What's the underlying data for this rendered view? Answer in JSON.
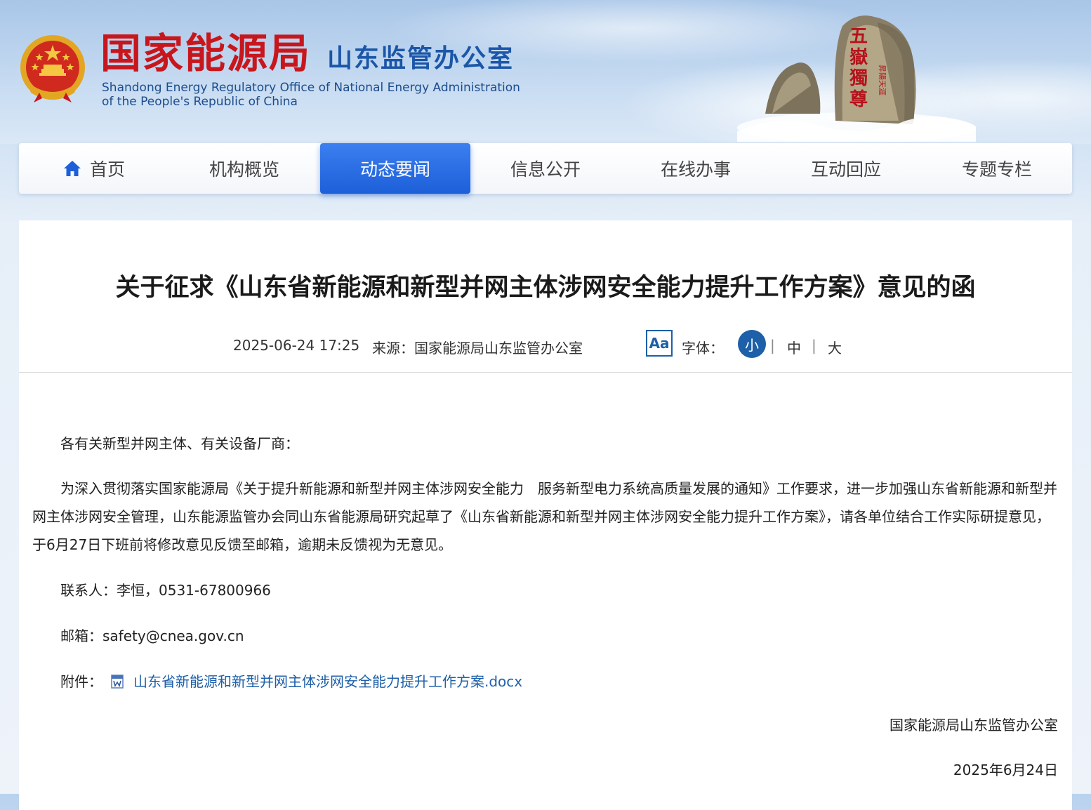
{
  "header": {
    "org_cn": "国家能源局",
    "office_cn": "山东监管办公室",
    "org_en_line1": "Shandong Energy Regulatory Office of National Energy Administration",
    "org_en_line2": "of the People's Republic of China",
    "mountain_inscription": "五嶽獨尊"
  },
  "nav": {
    "items": [
      {
        "label": "首页",
        "icon": "home-icon",
        "active": false
      },
      {
        "label": "机构概览",
        "active": false
      },
      {
        "label": "动态要闻",
        "active": true
      },
      {
        "label": "信息公开",
        "active": false
      },
      {
        "label": "在线办事",
        "active": false
      },
      {
        "label": "互动回应",
        "active": false
      },
      {
        "label": "专题专栏",
        "active": false
      }
    ],
    "active_color": "#1d5fd8"
  },
  "article": {
    "title": "关于征求《山东省新能源和新型并网主体涉网安全能力提升工作方案》意见的函",
    "date": "2025-06-24 17:25",
    "source": "来源：国家能源局山东监管办公室",
    "font_icon_text": "Aa",
    "font_label": "字体：",
    "font_sizes": {
      "small": "小",
      "medium": "中",
      "large": "大",
      "selected": "小",
      "separator": "|"
    },
    "greeting": "各有关新型并网主体、有关设备厂商：",
    "body": "为深入贯彻落实国家能源局《关于提升新能源和新型并网主体涉网安全能力　服务新型电力系统高质量发展的通知》工作要求，进一步加强山东省新能源和新型并网主体涉网安全管理，山东能源监管办会同山东省能源局研究起草了《山东省新能源和新型并网主体涉网安全能力提升工作方案》，请各单位结合工作实际研提意见，于6月27日下班前将修改意见反馈至邮箱，逾期未反馈视为无意见。",
    "contact": "联系人：李恒，0531-67800966",
    "email": "邮箱：safety@cnea.gov.cn",
    "attachment_label": "附件：",
    "attachment_file": "山东省新能源和新型并网主体涉网安全能力提升工作方案.docx",
    "signature": "国家能源局山东监管办公室",
    "sign_date": "2025年6月24日"
  },
  "colors": {
    "brand_red": "#c8161d",
    "brand_blue": "#1b56a8",
    "link_blue": "#1d5fa8"
  }
}
